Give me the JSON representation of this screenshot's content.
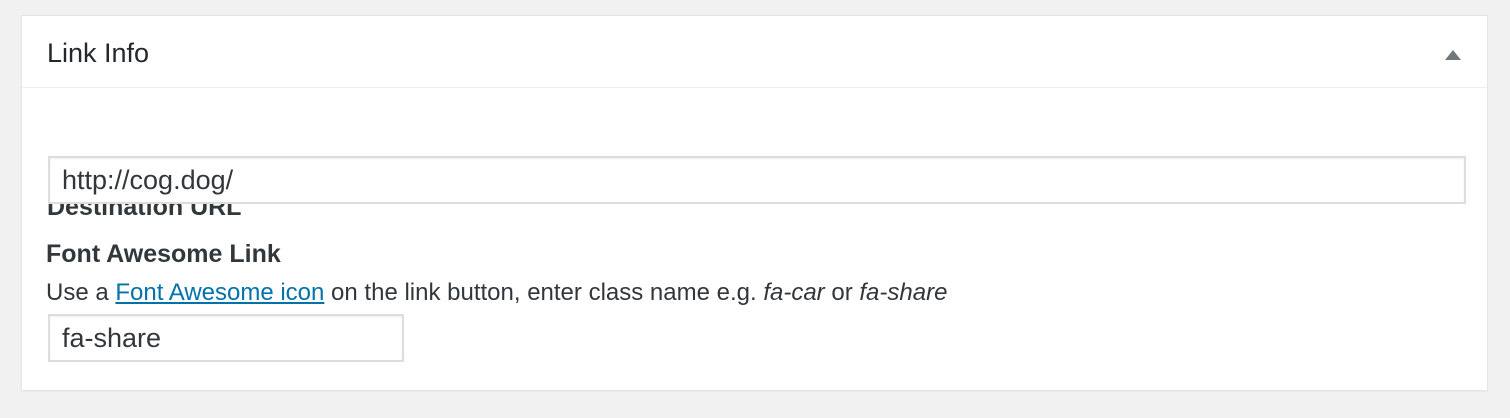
{
  "postbox": {
    "title": "Link Info",
    "toggle_icon": "triangle-up-icon"
  },
  "destination": {
    "label": "Destination URL",
    "value": "http://cog.dog/"
  },
  "font_awesome": {
    "label": "Font Awesome Link",
    "description_prefix": "Use a ",
    "link_text": "Font Awesome icon",
    "description_middle": " on the link button, enter class name e.g. ",
    "example_1": "fa-car",
    "description_or": " or ",
    "example_2": "fa-share",
    "value": "fa-share"
  },
  "colors": {
    "background": "#f1f1f1",
    "panel": "#ffffff",
    "link": "#0073aa",
    "text": "#23282d",
    "input_border": "#dddddd"
  }
}
